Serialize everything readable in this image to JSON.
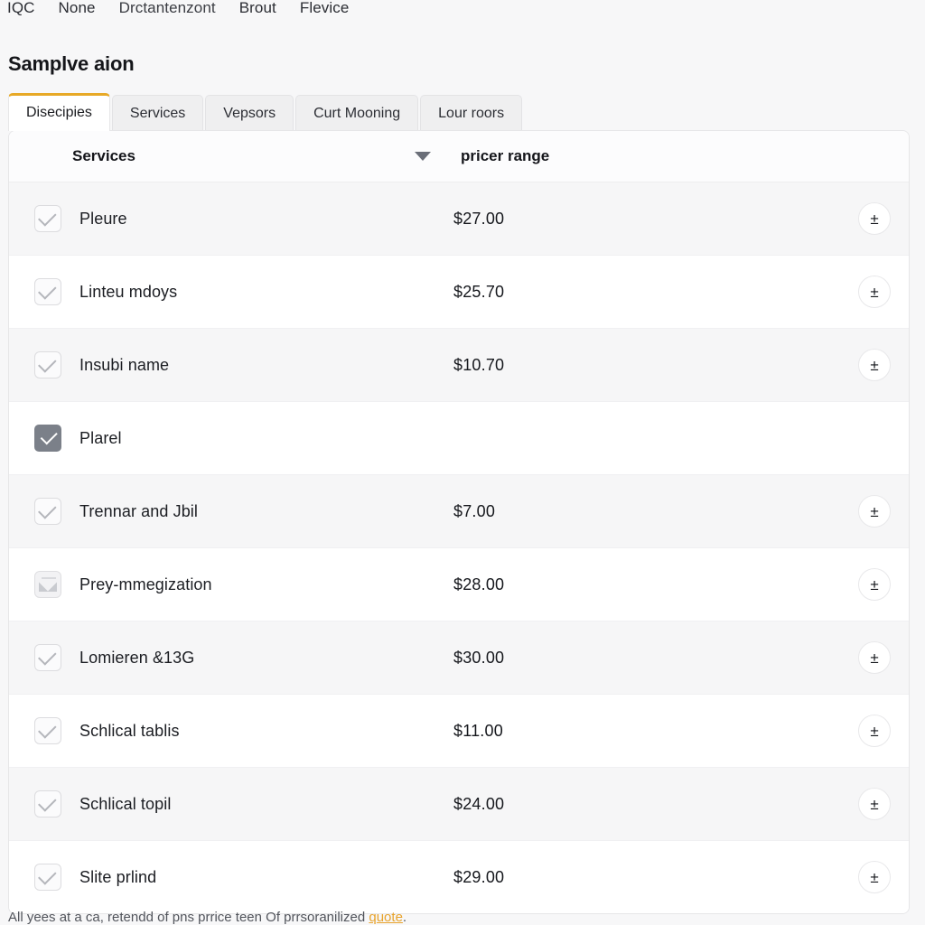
{
  "topnav": {
    "items": [
      {
        "label": "IQC"
      },
      {
        "label": "None"
      },
      {
        "label": "Drctantenzont"
      },
      {
        "label": "Brout"
      },
      {
        "label": "Flevice"
      }
    ]
  },
  "page": {
    "title": "Samplve aion"
  },
  "tabs": [
    {
      "label": "Disecipies",
      "active": true
    },
    {
      "label": "Services",
      "active": false
    },
    {
      "label": "Vepsors",
      "active": false
    },
    {
      "label": "Curt Mooning",
      "active": false
    },
    {
      "label": "Lour roors",
      "active": false
    }
  ],
  "table": {
    "columns": {
      "name": "Services",
      "price": "pricer range"
    },
    "sort_icon": "chevron-down-icon",
    "action_icon": "plus-minus-icon",
    "rows": [
      {
        "name": "Pleure",
        "price": "$27.00",
        "checkbox": "checked",
        "action": true
      },
      {
        "name": "Linteu mdoys",
        "price": "$25.70",
        "checkbox": "checked",
        "action": true
      },
      {
        "name": "Insubi name",
        "price": "$10.70",
        "checkbox": "checked",
        "action": true
      },
      {
        "name": "Plarel",
        "price": "",
        "checkbox": "filled",
        "action": false
      },
      {
        "name": "Trennar and Jbil",
        "price": "$7.00",
        "checkbox": "checked",
        "action": true
      },
      {
        "name": "Prey-mmegization",
        "price": "$28.00",
        "checkbox": "envelope",
        "action": true
      },
      {
        "name": "Lomieren &13G",
        "price": "$30.00",
        "checkbox": "checked",
        "action": true
      },
      {
        "name": "Schlical tablis",
        "price": "$11.00",
        "checkbox": "checked",
        "action": true
      },
      {
        "name": "Schlical topil",
        "price": "$24.00",
        "checkbox": "checked",
        "action": true
      },
      {
        "name": "Slite prlind",
        "price": "$29.00",
        "checkbox": "checked",
        "action": true
      }
    ]
  },
  "footer": {
    "text_before": "All yees at a ca, retendd of pns prrice teen Of prrsoranilized ",
    "link": "quote",
    "text_after": "."
  },
  "colors": {
    "accent": "#e7a927",
    "link": "#e8a32c",
    "page_bg": "#f7f7f8",
    "card_bg": "#ffffff",
    "row_alt_bg": "#f6f6f7"
  }
}
